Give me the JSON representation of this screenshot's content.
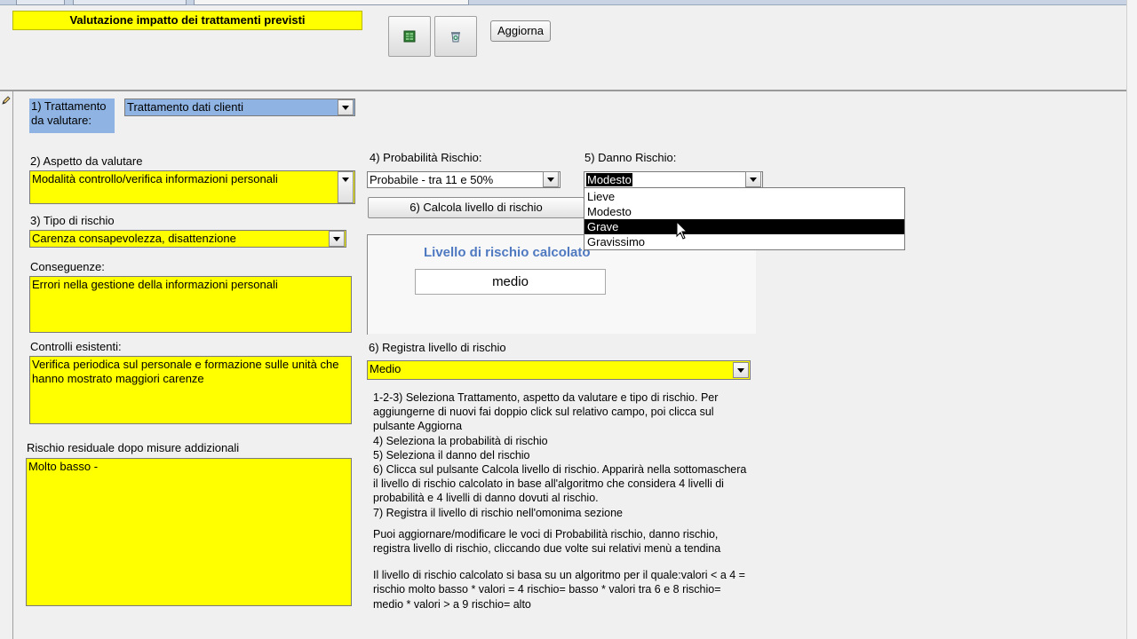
{
  "header": {
    "title": "Valutazione impatto dei trattamenti previsti",
    "refresh_label": "Aggiorna"
  },
  "form": {
    "trattamento": {
      "label": "1) Trattamento da valutare:",
      "value": "Trattamento dati clienti"
    },
    "aspetto": {
      "label": "2) Aspetto da valutare",
      "value": "Modalità controllo/verifica informazioni personali"
    },
    "tipo": {
      "label": "3) Tipo di rischio",
      "value": "Carenza consapevolezza, disattenzione"
    },
    "conseguenze": {
      "label": "Conseguenze:",
      "value": "Errori nella gestione della informazioni personali"
    },
    "controlli": {
      "label": "Controlli esistenti:",
      "value": "Verifica periodica  sul personale  e formazione sulle unità che hanno mostrato maggiori carenze"
    },
    "residuo": {
      "label": "Rischio residuale dopo misure addizionali",
      "value": "Molto basso  -"
    },
    "probabilita": {
      "label": "4) Probabilità Rischio:",
      "value": "Probabile - tra 11 e 50%"
    },
    "danno": {
      "label": "5) Danno Rischio:",
      "value": "Modesto",
      "options": [
        "Lieve",
        "Modesto",
        "Grave",
        "Gravissimo"
      ],
      "highlighted": "Grave"
    },
    "calcola_label": "6) Calcola livello di rischio",
    "calcolato": {
      "title": "Livello di rischio calcolato",
      "value": "medio"
    },
    "registra": {
      "label": "6) Registra livello di rischio",
      "value": "Medio"
    }
  },
  "instructions": [
    "1-2-3) Seleziona Trattamento, aspetto da valutare e tipo di rischio. Per aggiungerne di nuovi fai doppio click sul relativo campo, poi clicca sul pulsante Aggiorna",
    "4) Seleziona la probabilità di rischio",
    "5) Seleziona il danno del rischio",
    "6) Clicca sul pulsante Calcola livello di rischio. Apparirà nella sottomaschera il livello di rischio calcolato in base all'algoritmo che considera 4 livelli di probabilità e 4 livelli di danno dovuti al rischio.",
    "7) Registra il livello di rischio nell'omonima sezione",
    "Puoi aggiornare/modificare le voci di Probabilità rischio, danno rischio, registra livello di rischio, cliccando due volte sui relativi menù a tendina",
    "Il livello di rischio calcolato si basa su un algoritmo per il quale:valori < a 4 = rischio molto basso * valori = 4 rischio= basso * valori tra 6 e 8 rischio= medio * valori > a 9 rischio= alto"
  ],
  "icons": {
    "excel": "excel-icon",
    "recycle": "recycle-bin-icon",
    "pencil": "pencil-icon"
  },
  "colors": {
    "field_yellow": "#ffff00",
    "field_blue": "#8fb4e3",
    "subform_title": "#4f79c0"
  }
}
